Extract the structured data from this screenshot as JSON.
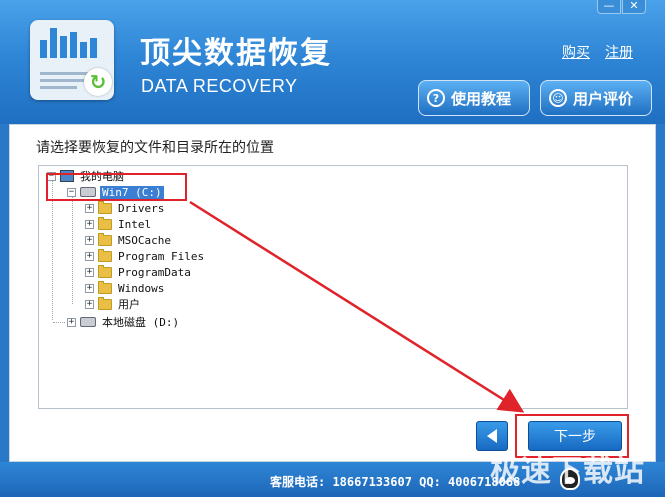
{
  "window_controls": {
    "minimize": "—",
    "close": "✕"
  },
  "header": {
    "title_cn": "顶尖数据恢复",
    "title_en": "DATA RECOVERY",
    "links": {
      "buy": "购买",
      "register": "注册"
    },
    "buttons": {
      "tutorial": {
        "label": "使用教程",
        "icon": "question-icon",
        "glyph": "?"
      },
      "review": {
        "label": "用户评价",
        "icon": "chat-icon",
        "glyph": "☺"
      }
    }
  },
  "main": {
    "prompt": "请选择要恢复的文件和目录所在的位置",
    "tree": {
      "root": "我的电脑",
      "drive_c": "Win7 (C:)",
      "folders": [
        "Drivers",
        "Intel",
        "MSOCache",
        "Program Files",
        "ProgramData",
        "Windows",
        "用户"
      ],
      "drive_d": "本地磁盘 (D:)"
    },
    "buttons": {
      "back_icon": "left-arrow-icon",
      "next": "下一步"
    }
  },
  "footer": {
    "service": "客服电话: 18667133607  QQ: 4006718068",
    "watermark": "极速下载站"
  },
  "colors": {
    "accent": "#2f86d6",
    "highlight_box": "#e0232b",
    "selection": "#3a7fd4"
  }
}
